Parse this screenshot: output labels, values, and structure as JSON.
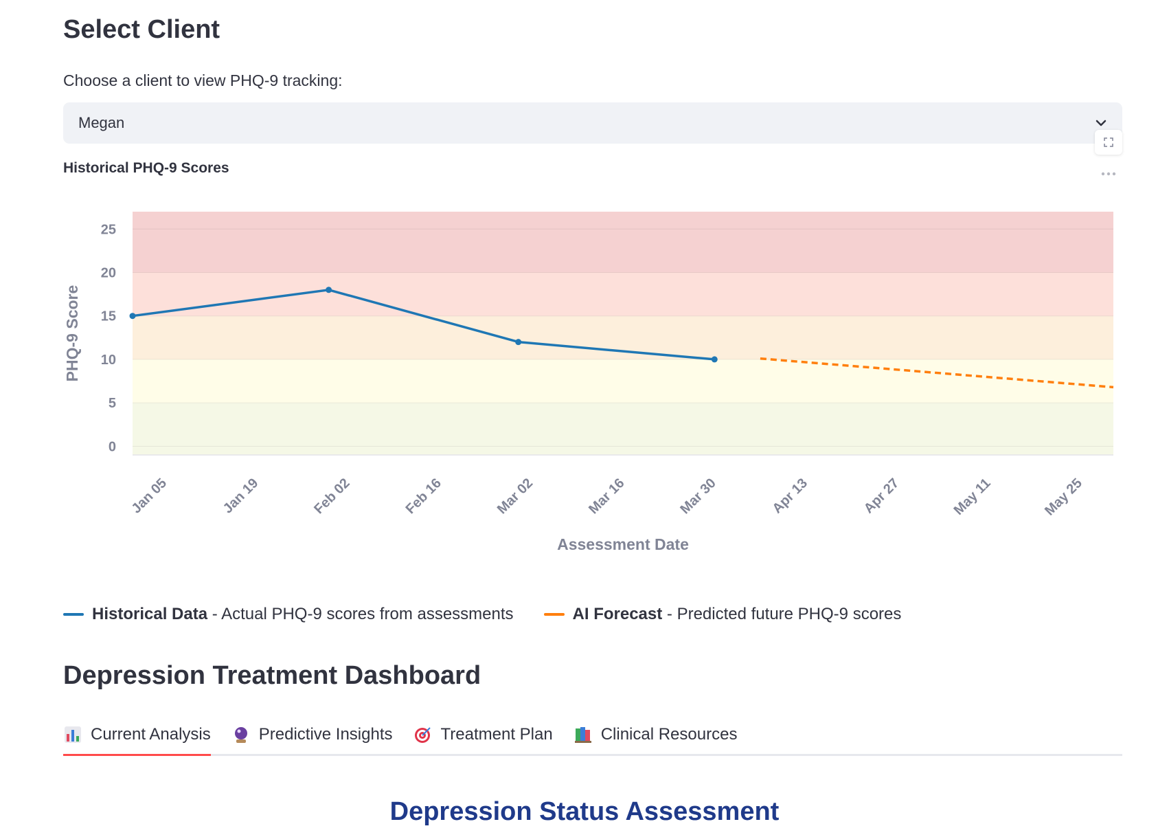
{
  "header": {
    "title": "Select Client"
  },
  "client_select": {
    "label": "Choose a client to view PHQ-9 tracking:",
    "selected": "Megan"
  },
  "chart_title": "Historical PHQ-9 Scores",
  "chart_data": {
    "type": "line",
    "xlabel": "Assessment Date",
    "ylabel": "PHQ-9 Score",
    "ylim": [
      -1,
      27
    ],
    "yticks": [
      0,
      5,
      10,
      15,
      20,
      25
    ],
    "xlim": [
      "2025-01-02",
      "2025-06-01"
    ],
    "xticks": [
      {
        "date": "2025-01-05",
        "label": "Jan 05"
      },
      {
        "date": "2025-01-19",
        "label": "Jan 19"
      },
      {
        "date": "2025-02-02",
        "label": "Feb 02"
      },
      {
        "date": "2025-02-16",
        "label": "Feb 16"
      },
      {
        "date": "2025-03-02",
        "label": "Mar 02"
      },
      {
        "date": "2025-03-16",
        "label": "Mar 16"
      },
      {
        "date": "2025-03-30",
        "label": "Mar 30"
      },
      {
        "date": "2025-04-13",
        "label": "Apr 13"
      },
      {
        "date": "2025-04-27",
        "label": "Apr 27"
      },
      {
        "date": "2025-05-11",
        "label": "May 11"
      },
      {
        "date": "2025-05-25",
        "label": "May 25"
      }
    ],
    "severity_bands": [
      {
        "from": -1,
        "to": 5,
        "color": "#f5f8e6"
      },
      {
        "from": 5,
        "to": 10,
        "color": "#fffde8"
      },
      {
        "from": 10,
        "to": 15,
        "color": "#fdefdc"
      },
      {
        "from": 15,
        "to": 20,
        "color": "#fde0da"
      },
      {
        "from": 20,
        "to": 27,
        "color": "#f5d1d1"
      }
    ],
    "series": [
      {
        "style": "solid",
        "color": "#1f77b4",
        "points": [
          {
            "x": "2025-01-02",
            "y": 15
          },
          {
            "x": "2025-02-01",
            "y": 18
          },
          {
            "x": "2025-03-02",
            "y": 12
          },
          {
            "x": "2025-04-01",
            "y": 10
          }
        ]
      },
      {
        "style": "dashed",
        "color": "#ff7f0e",
        "points": [
          {
            "x": "2025-04-08",
            "y": 10.1
          },
          {
            "x": "2025-06-01",
            "y": 6.8
          }
        ]
      }
    ]
  },
  "legend": [
    {
      "name": "Historical Data",
      "desc": " - Actual PHQ-9 scores from assessments",
      "color": "#1f77b4"
    },
    {
      "name": "AI Forecast",
      "desc": " - Predicted future PHQ-9 scores",
      "color": "#ff7f0e"
    }
  ],
  "dashboard": {
    "title": "Depression Treatment Dashboard",
    "tabs": [
      {
        "label": "Current Analysis",
        "icon": "bar-chart-icon"
      },
      {
        "label": "Predictive Insights",
        "icon": "crystal-ball-icon"
      },
      {
        "label": "Treatment Plan",
        "icon": "target-icon"
      },
      {
        "label": "Clinical Resources",
        "icon": "books-icon"
      }
    ]
  },
  "status": {
    "title": "Depression Status Assessment"
  }
}
